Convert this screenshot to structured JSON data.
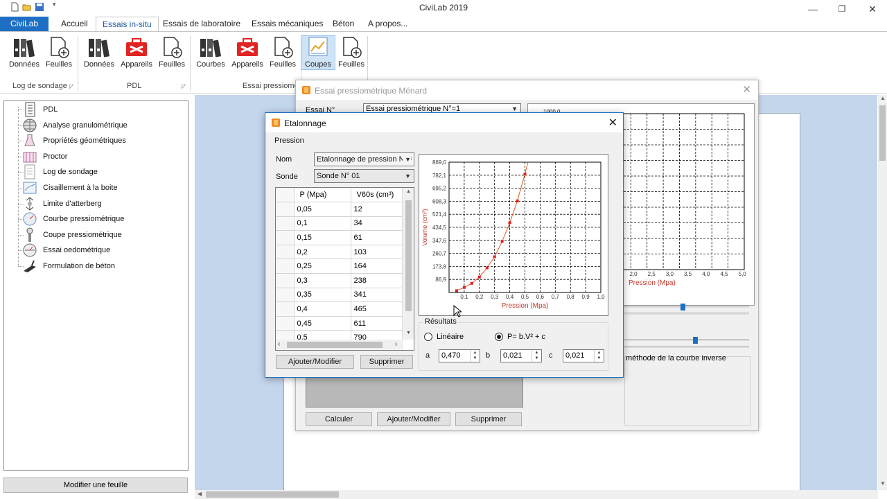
{
  "app": {
    "title": "CiviLab 2019"
  },
  "tabs": [
    {
      "label": "CiviLab"
    },
    {
      "label": "Accueil"
    },
    {
      "label": "Essais in-situ"
    },
    {
      "label": "Essais de laboratoire"
    },
    {
      "label": "Essais mécaniques"
    },
    {
      "label": "Béton"
    },
    {
      "label": "A propos..."
    }
  ],
  "ribbon": {
    "buttons": [
      "Données",
      "Feuilles",
      "Données",
      "Appareils",
      "Feuilles",
      "Courbes",
      "Appareils",
      "Feuilles",
      "Coupes",
      "Feuilles"
    ],
    "groups": [
      "Log de sondage",
      "PDL",
      "Essai pressiome"
    ]
  },
  "tree": {
    "items": [
      "PDL",
      "Analyse granulométrique",
      "Propriétés géométriques",
      "Proctor",
      "Log de sondage",
      "Cisaillement à la boite",
      "Limite d'atterberg",
      "Courbe pressiométrique",
      "Coupe pressiométrique",
      "Essai oedométrique",
      "Formulation de béton"
    ]
  },
  "left_bottom_button": "Modifier une feuille",
  "back_window": {
    "title": "Essai pressiométrique Ménard",
    "essai_label": "Essai N°",
    "essai_value": "Essai pressiométrique N°=1",
    "axis_partial_top": "1000,0",
    "x_ticks": [
      "2,0",
      "2,5",
      "3,0",
      "3,5",
      "4,0",
      "4,5",
      "5,0"
    ],
    "x_label": "Pression (Mpa)",
    "method_text": "méthode de la courbe inverse",
    "buttons": [
      "Calculer",
      "Ajouter/Modifier",
      "Supprimer"
    ],
    "slider1": 0.45,
    "slider2": 0.55
  },
  "dialog": {
    "title": "Etalonnage",
    "group_label": "Pression",
    "nom_label": "Nom",
    "nom_value": "Etalonnage de pression N°=",
    "sonde_label": "Sonde",
    "sonde_value": "Sonde N° 01",
    "table": {
      "headers": [
        "P (Mpa)",
        "V60s (cm³)"
      ],
      "rows": [
        [
          "0,05",
          "12"
        ],
        [
          "0,1",
          "34"
        ],
        [
          "0,15",
          "61"
        ],
        [
          "0,2",
          "103"
        ],
        [
          "0,25",
          "164"
        ],
        [
          "0,3",
          "238"
        ],
        [
          "0,35",
          "341"
        ],
        [
          "0,4",
          "465"
        ],
        [
          "0,45",
          "611"
        ],
        [
          "0,5",
          "790"
        ]
      ]
    },
    "buttons": {
      "add": "Ajouter/Modifier",
      "delete": "Supprimer"
    },
    "results": {
      "label": "Résultats",
      "option_linear": "Linéaire",
      "option_poly": "P= b.V² + c",
      "selected": "poly",
      "a_label": "a",
      "a_value": "0,470",
      "b_label": "b",
      "b_value": "0,021",
      "c_label": "c",
      "c_value": "0,021"
    }
  },
  "chart_data": {
    "type": "scatter",
    "xlabel": "Pression (Mpa)",
    "ylabel": "Volume (cm³)",
    "xlim": [
      0,
      1.0
    ],
    "ylim": [
      0,
      869.0
    ],
    "x_ticks": [
      "0,1",
      "0,2",
      "0,3",
      "0,4",
      "0,5",
      "0,6",
      "0,7",
      "0,8",
      "0,9",
      "1,0"
    ],
    "y_ticks": [
      "86,9",
      "173,8",
      "260,7",
      "347,6",
      "434,5",
      "521,4",
      "608,3",
      "695,2",
      "782,1",
      "869,0"
    ],
    "grid": true,
    "series": [
      {
        "values": [
          [
            0.05,
            12
          ],
          [
            0.1,
            34
          ],
          [
            0.15,
            61
          ],
          [
            0.2,
            103
          ],
          [
            0.25,
            164
          ],
          [
            0.3,
            238
          ],
          [
            0.35,
            341
          ],
          [
            0.4,
            465
          ],
          [
            0.45,
            611
          ],
          [
            0.5,
            790
          ]
        ],
        "color": "#e02020"
      }
    ],
    "fit_line_color": "#e05a20"
  }
}
